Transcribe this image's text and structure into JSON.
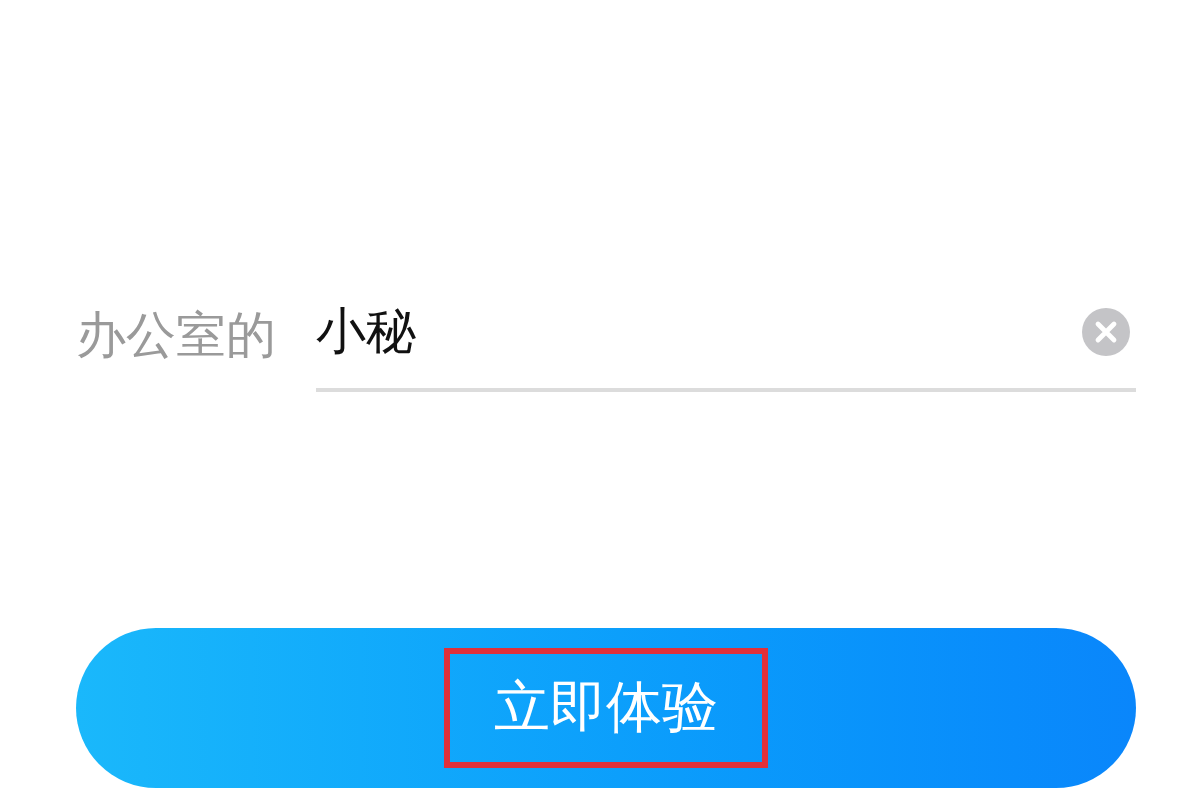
{
  "field": {
    "label": "办公室的",
    "value": "小秘"
  },
  "button": {
    "label": "立即体验",
    "highlighted": true
  }
}
